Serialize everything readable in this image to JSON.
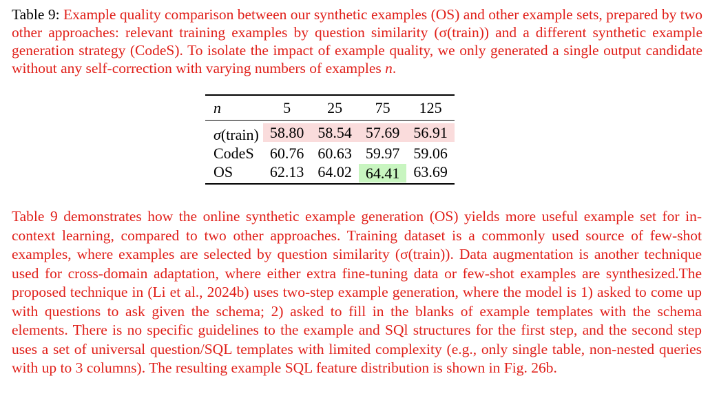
{
  "caption": {
    "label": "Table 9:",
    "text": "Example quality comparison between our synthetic examples (OS) and other example sets, prepared by two other approaches: relevant training examples by question similarity (σ(train)) and a different synthetic example generation strategy (CodeS). To isolate the impact of example quality, we only generated a single output candidate without any self-correction with varying numbers of examples ",
    "var": "n",
    "end": "."
  },
  "table": {
    "header": [
      "n",
      "5",
      "25",
      "75",
      "125"
    ],
    "rows": [
      {
        "label": "σ(train)",
        "values": [
          "58.80",
          "58.54",
          "57.69",
          "56.91"
        ]
      },
      {
        "label": "CodeS",
        "values": [
          "60.76",
          "60.63",
          "59.97",
          "59.06"
        ]
      },
      {
        "label": "OS",
        "values": [
          "62.13",
          "64.02",
          "64.41",
          "63.69"
        ]
      }
    ],
    "highlight_colors": {
      "red_row": "#fadcdc",
      "green_cell": "#c8f5c0"
    }
  },
  "paragraph": "Table 9 demonstrates how the online synthetic example generation (OS) yields more useful example set for in-context learning, compared to two other approaches. Training dataset is a commonly used source of few-shot examples, where examples are selected by question similarity (σ(train)). Data augmentation is another technique used for cross-domain adaptation, where either extra fine-tuning data or few-shot examples are synthesized.The proposed technique in (Li et al., 2024b) uses two-step example generation, where the model is 1) asked to come up with questions to ask given the schema; 2) asked to fill in the blanks of example templates with the schema elements. There is no specific guidelines to the example and SQl structures for the first step, and the second step uses a set of universal question/SQL templates with limited complexity (e.g., only single table, non-nested queries with up to 3 columns). The resulting example SQL feature distribution is shown in Fig. 26b.",
  "colors": {
    "text_accent": "#e0201a",
    "text_main": "#000000"
  }
}
